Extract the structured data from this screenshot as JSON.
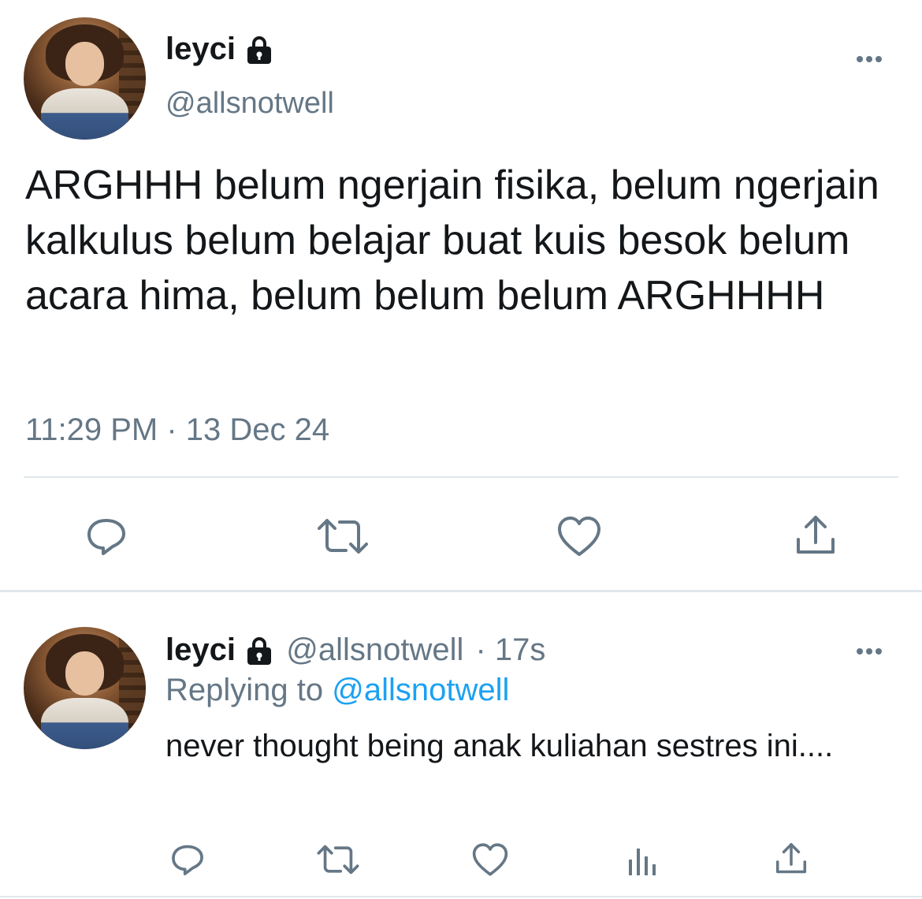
{
  "main_tweet": {
    "display_name": "leyci",
    "handle": "@allsnotwell",
    "text": "ARGHHH belum ngerjain fisika, belum ngerjain kalkulus belum belajar buat kuis besok belum acara hima, belum belum belum ARGHHHH",
    "timestamp": "11:29 PM · 13 Dec 24",
    "actions": [
      "reply-icon",
      "retweet-icon",
      "like-icon",
      "share-icon"
    ]
  },
  "reply_tweet": {
    "display_name": "leyci",
    "handle": "@allsnotwell",
    "age": "· 17s",
    "replying_prefix": "Replying to",
    "replying_to": "@allsnotwell",
    "text": "never thought being anak kuliahan sestres ini....",
    "actions": [
      "reply-icon",
      "retweet-icon",
      "like-icon",
      "analytics-icon",
      "share-icon"
    ]
  },
  "colors": {
    "text": "#14171a",
    "muted": "#657786",
    "link": "#1da1f2",
    "divider": "#e1e8ed"
  }
}
